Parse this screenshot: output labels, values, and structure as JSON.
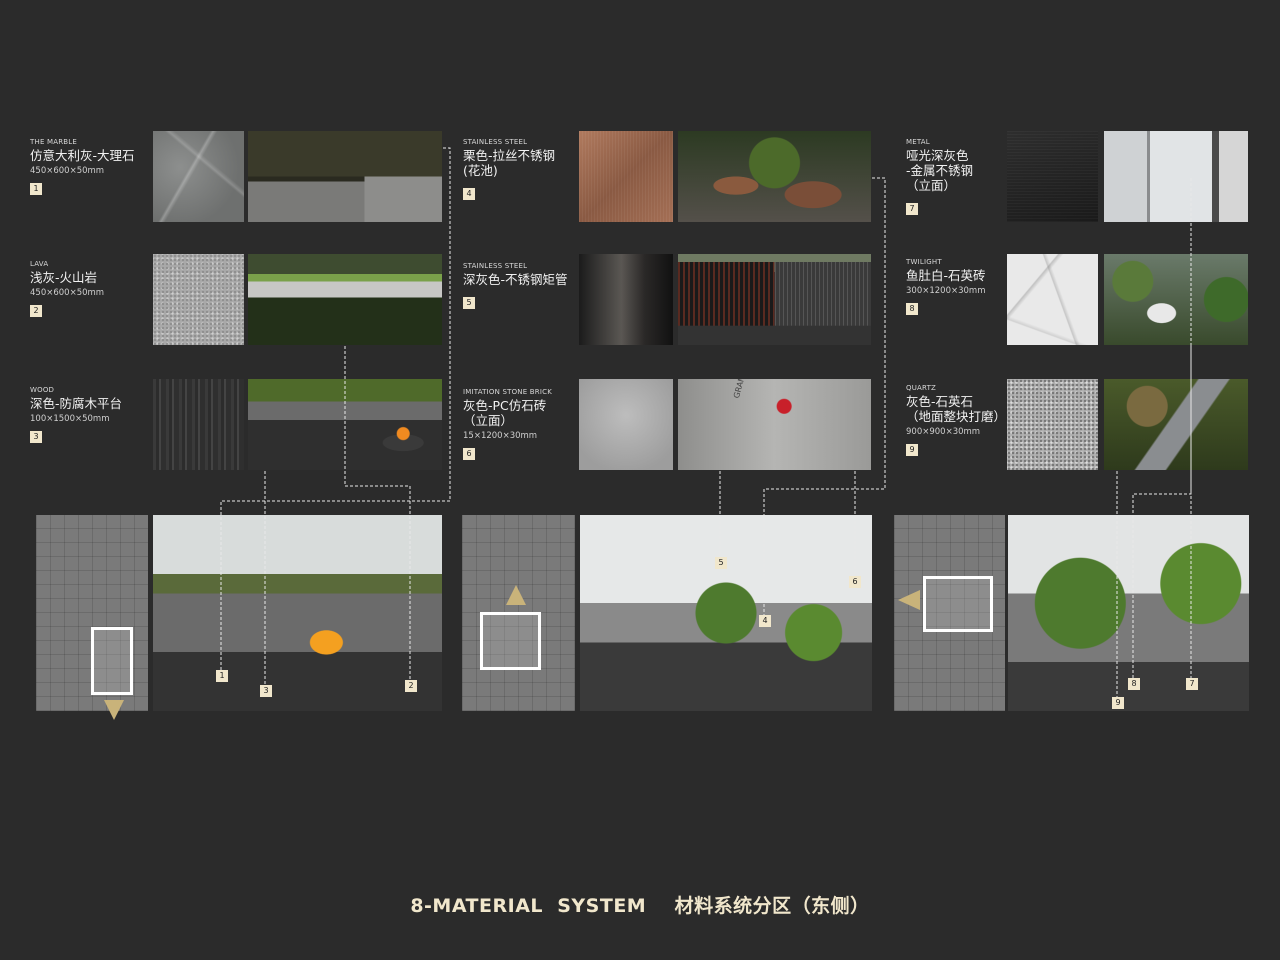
{
  "materials": [
    {
      "en": "THE MARBLE",
      "cn": "仿意大利灰-大理石",
      "dim": "450×600×50mm",
      "num": "1"
    },
    {
      "en": "LAVA",
      "cn": "浅灰-火山岩",
      "dim": "450×600×50mm",
      "num": "2"
    },
    {
      "en": "WOOD",
      "cn": "深色-防腐木平台",
      "dim": "100×1500×50mm",
      "num": "3"
    },
    {
      "en": "STAINLESS STEEL",
      "cn": "栗色-拉丝不锈钢\n(花池)",
      "dim": "",
      "num": "4"
    },
    {
      "en": "STAINLESS STEEL",
      "cn": "深灰色-不锈钢矩管",
      "dim": "",
      "num": "5"
    },
    {
      "en": "IMITATION STONE BRICK",
      "cn": "灰色-PC仿石砖\n（立面）",
      "dim": "15×1200×30mm",
      "num": "6"
    },
    {
      "en": "METAL",
      "cn": "哑光深灰色\n-金属不锈钢\n（立面）",
      "dim": "",
      "num": "7"
    },
    {
      "en": "TWILIGHT",
      "cn": "鱼肚白-石英砖",
      "dim": "300×1200×30mm",
      "num": "8"
    },
    {
      "en": "QUARTZ",
      "cn": "灰色-石英石\n（地面整块打磨）",
      "dim": "900×900×30mm",
      "num": "9"
    }
  ],
  "sign_text": "GRANDS",
  "pins": [
    "1",
    "2",
    "3",
    "4",
    "5",
    "6",
    "7",
    "8",
    "9"
  ],
  "footer": "8-MATERIAL  SYSTEM    材料系统分区（东侧）"
}
